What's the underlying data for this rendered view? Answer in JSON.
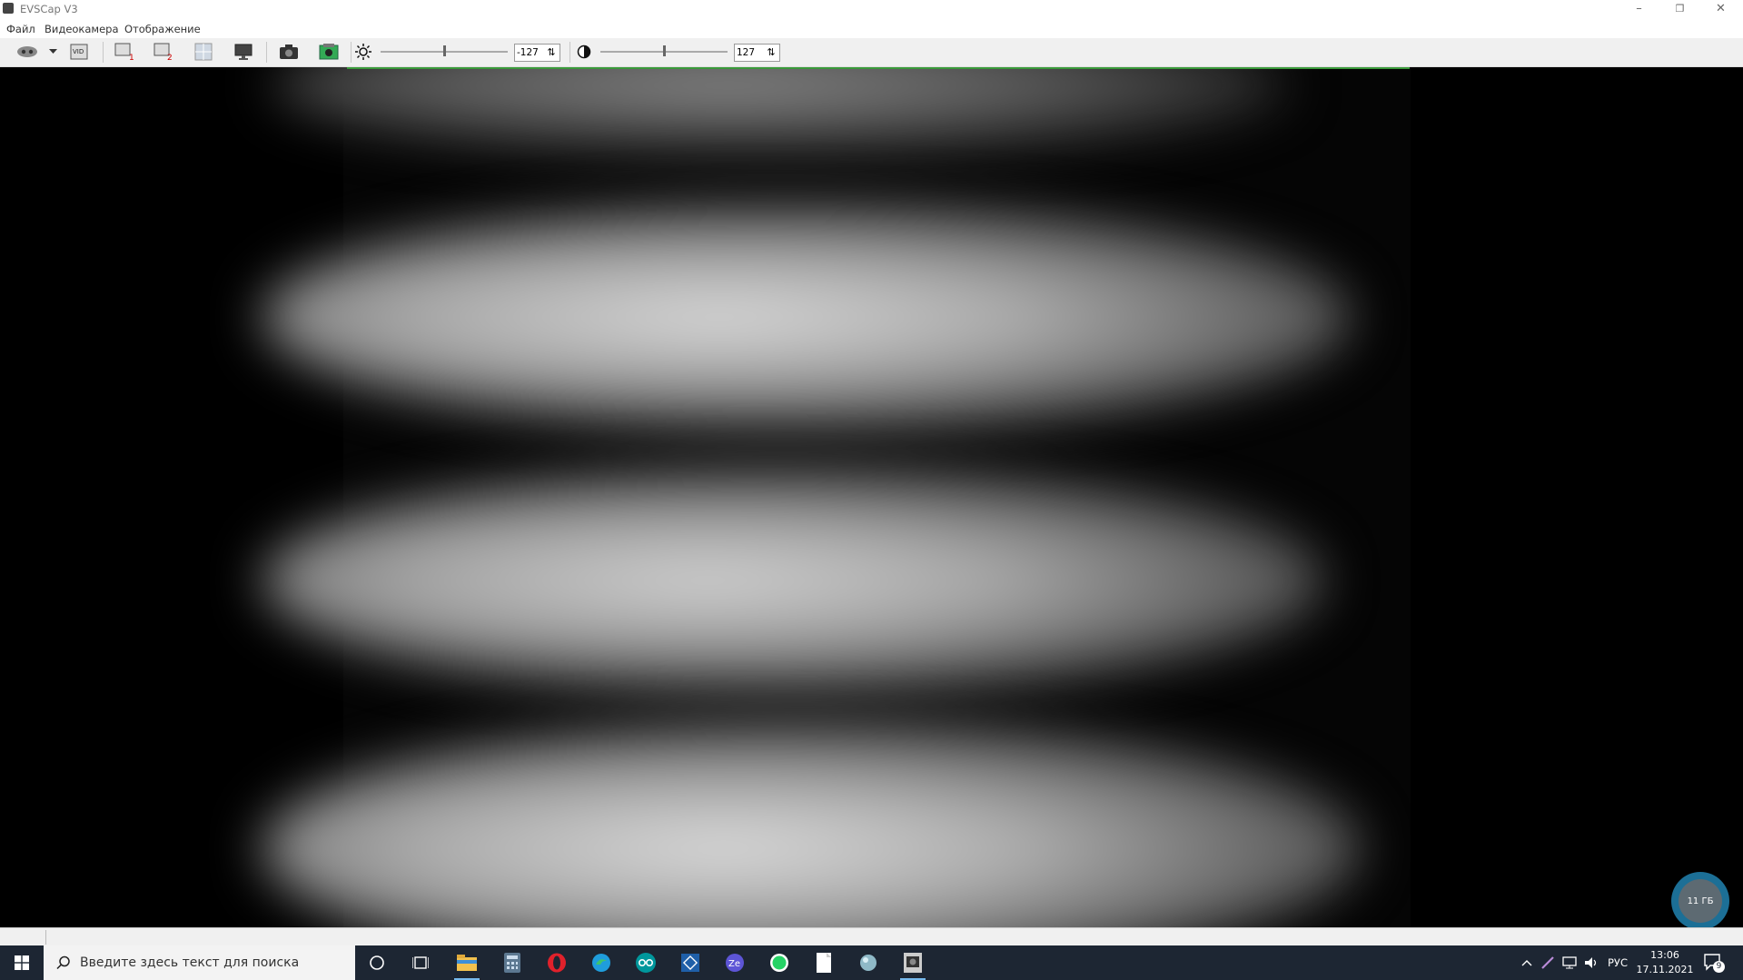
{
  "window": {
    "title": "EVSCap V3",
    "controls": {
      "minimize": "–",
      "restore": "❐",
      "close": "✕"
    }
  },
  "menu": {
    "items": [
      "Файл",
      "Видеокамера",
      "Отображение"
    ]
  },
  "toolbar": {
    "brightness": {
      "value": "-127",
      "slider_level": 0.5
    },
    "contrast": {
      "value": "127",
      "slider_level": 0.5
    },
    "buttons": [
      "webcam-source",
      "source-dropdown",
      "video-settings",
      "video-device-1",
      "video-device-2",
      "grid-view",
      "display-mode",
      "snapshot",
      "save-image"
    ]
  },
  "status": {
    "storage_badge": "11 ГБ"
  },
  "taskbar": {
    "search_placeholder": "Введите здесь текст для поиска",
    "pinned": [
      "cortana",
      "task-view",
      "file-explorer",
      "calculator",
      "opera",
      "edge",
      "arduino",
      "cpu-z",
      "zello",
      "whatsapp",
      "notepad",
      "app-orb",
      "evscap"
    ],
    "language": "РУС",
    "time": "13:06",
    "date": "17.11.2021",
    "notifications_count": "9"
  },
  "colors": {
    "taskbar_bg": "#1d2633",
    "accent": "#76b9ed",
    "badge": "#1c6f96"
  }
}
